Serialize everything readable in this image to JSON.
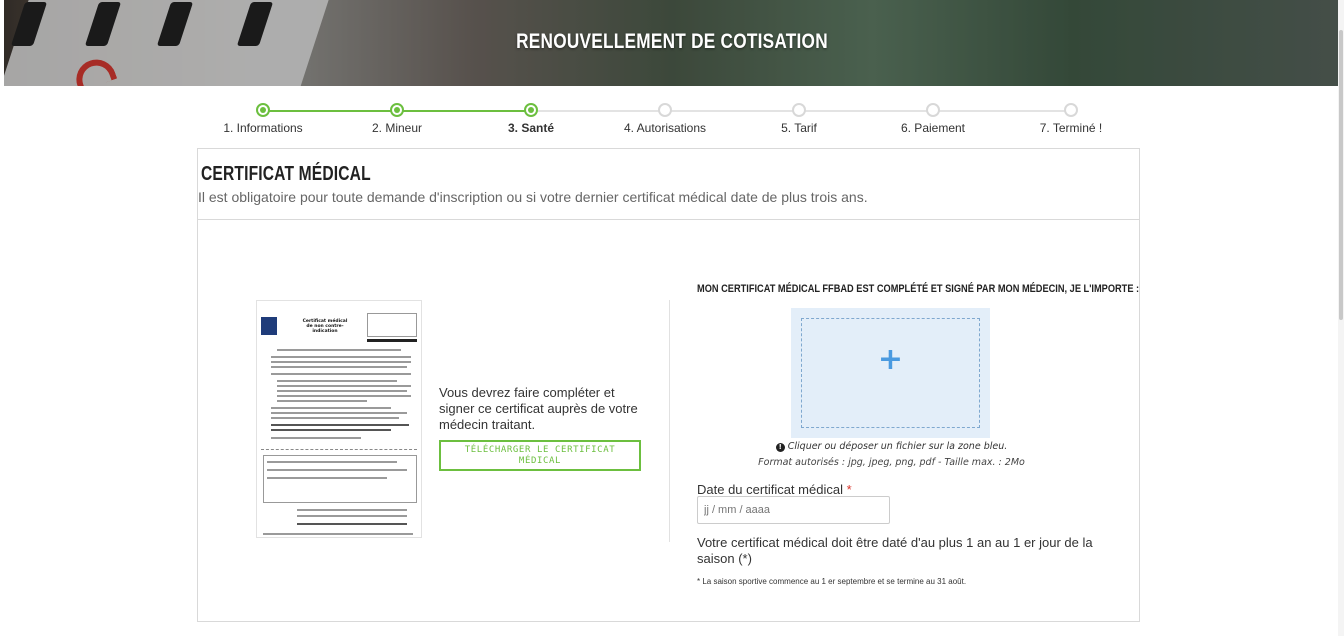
{
  "banner": {
    "title": "RENOUVELLEMENT DE COTISATION"
  },
  "steps": [
    {
      "label": "1. Informations",
      "state": "done"
    },
    {
      "label": "2. Mineur",
      "state": "done"
    },
    {
      "label": "3. Santé",
      "state": "active"
    },
    {
      "label": "4. Autorisations",
      "state": "todo"
    },
    {
      "label": "5. Tarif",
      "state": "todo"
    },
    {
      "label": "6. Paiement",
      "state": "todo"
    },
    {
      "label": "7. Terminé !",
      "state": "todo"
    }
  ],
  "section": {
    "title": "CERTIFICAT MÉDICAL",
    "subtitle": "Il est obligatoire pour toute demande d'inscription ou si votre dernier certificat médical date de plus trois ans."
  },
  "left": {
    "certificate_title_line1": "Certificat médical",
    "certificate_title_line2": "de non contre-indication",
    "info_text": "Vous devrez faire compléter et signer ce certificat auprès de votre médecin traitant.",
    "download_button": "TÉLÉCHARGER LE CERTIFICAT MÉDICAL"
  },
  "right": {
    "upload_title": "MON CERTIFICAT MÉDICAL FFBAD EST COMPLÉTÉ ET SIGNÉ PAR MON MÉDECIN, JE L'IMPORTE :",
    "dropzone_icon": "+",
    "drop_hint": "Cliquer ou déposer un fichier sur la zone bleu.",
    "drop_format": "Format autorisés : jpg, jpeg, png, pdf - Taille max. : 2Mo",
    "date_label": "Date du certificat médical",
    "required_mark": "*",
    "date_placeholder": "jj / mm / aaaa",
    "date_note": "Votre certificat médical doit être daté d'au plus 1 an au 1 er jour de la saison (*)",
    "season_note": "* La saison sportive commence au 1 er septembre et se termine au 31 août."
  },
  "colors": {
    "accent_green": "#6cbf3f",
    "dropzone_bg": "#e3eef9",
    "plus_blue": "#4a9ae0",
    "required_red": "#d9352c"
  }
}
